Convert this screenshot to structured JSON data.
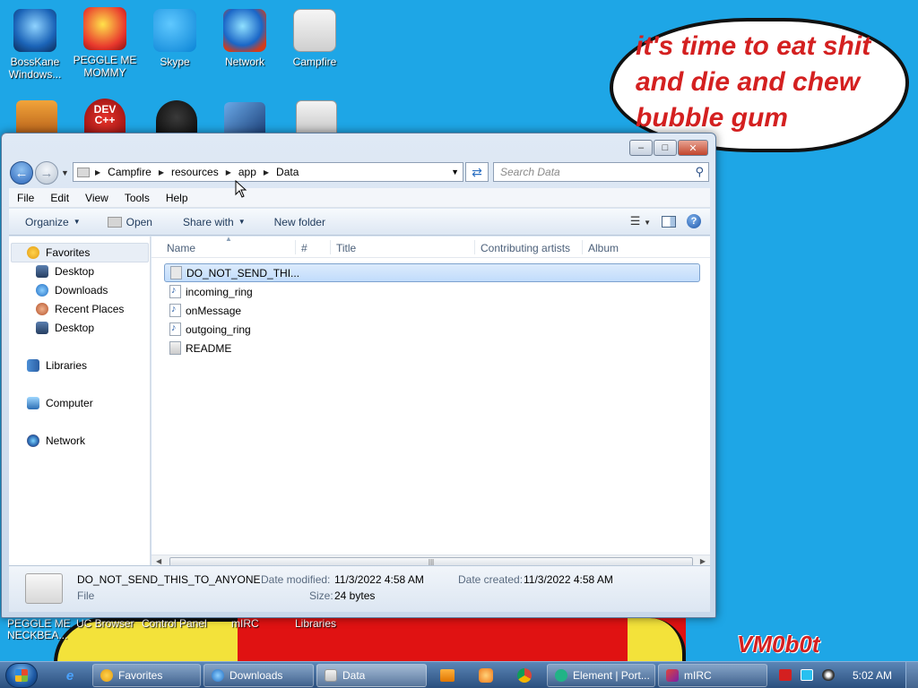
{
  "desktop": {
    "icons_row1": [
      {
        "label": "BossKane Windows...",
        "name": "bosskane"
      },
      {
        "label": "PEGGLE ME MOMMY",
        "name": "peggle"
      },
      {
        "label": "Skype",
        "name": "skype"
      },
      {
        "label": "Network",
        "name": "network"
      },
      {
        "label": "Campfire",
        "name": "campfire"
      }
    ],
    "row2_dev_label": "DEV\nC++",
    "bottom_labels": [
      "PEGGLE ME\nNECKBEA...",
      "UC Browser",
      "Control Panel",
      "mIRC",
      "Libraries"
    ],
    "speech_bubble": "it's time to eat shit and die and chew bubble gum",
    "watermark": "VM0b0t",
    "colors": {
      "background": "#1ea6e6",
      "speech_text": "#d42020"
    }
  },
  "window": {
    "breadcrumbs": [
      "Campfire",
      "resources",
      "app",
      "Data"
    ],
    "search_placeholder": "Search Data",
    "menu": [
      "File",
      "Edit",
      "View",
      "Tools",
      "Help"
    ],
    "commands": {
      "organize": "Organize",
      "open": "Open",
      "share_with": "Share with",
      "new_folder": "New folder"
    },
    "nav": {
      "favorites": "Favorites",
      "desktop": "Desktop",
      "downloads": "Downloads",
      "recent_places": "Recent Places",
      "desktop2": "Desktop",
      "libraries": "Libraries",
      "computer": "Computer",
      "network": "Network"
    },
    "columns": [
      "Name",
      "#",
      "Title",
      "Contributing artists",
      "Album"
    ],
    "files": [
      {
        "name": "DO_NOT_SEND_THI...",
        "icon": "blank-file-icon",
        "selected": true
      },
      {
        "name": "incoming_ring",
        "icon": "audio-file-icon"
      },
      {
        "name": "onMessage",
        "icon": "audio-file-icon"
      },
      {
        "name": "outgoing_ring",
        "icon": "audio-file-icon"
      },
      {
        "name": "README",
        "icon": "text-file-icon"
      }
    ],
    "details": {
      "filename": "DO_NOT_SEND_THIS_TO_ANYONE",
      "type": "File",
      "modified_label": "Date modified:",
      "modified": "11/3/2022 4:58 AM",
      "created_label": "Date created:",
      "created": "11/3/2022 4:58 AM",
      "size_label": "Size:",
      "size": "24 bytes"
    }
  },
  "taskbar": {
    "buttons": [
      "Favorites",
      "Downloads",
      "Data",
      "Element | Port...",
      "mIRC"
    ],
    "clock": "5:02 AM"
  }
}
